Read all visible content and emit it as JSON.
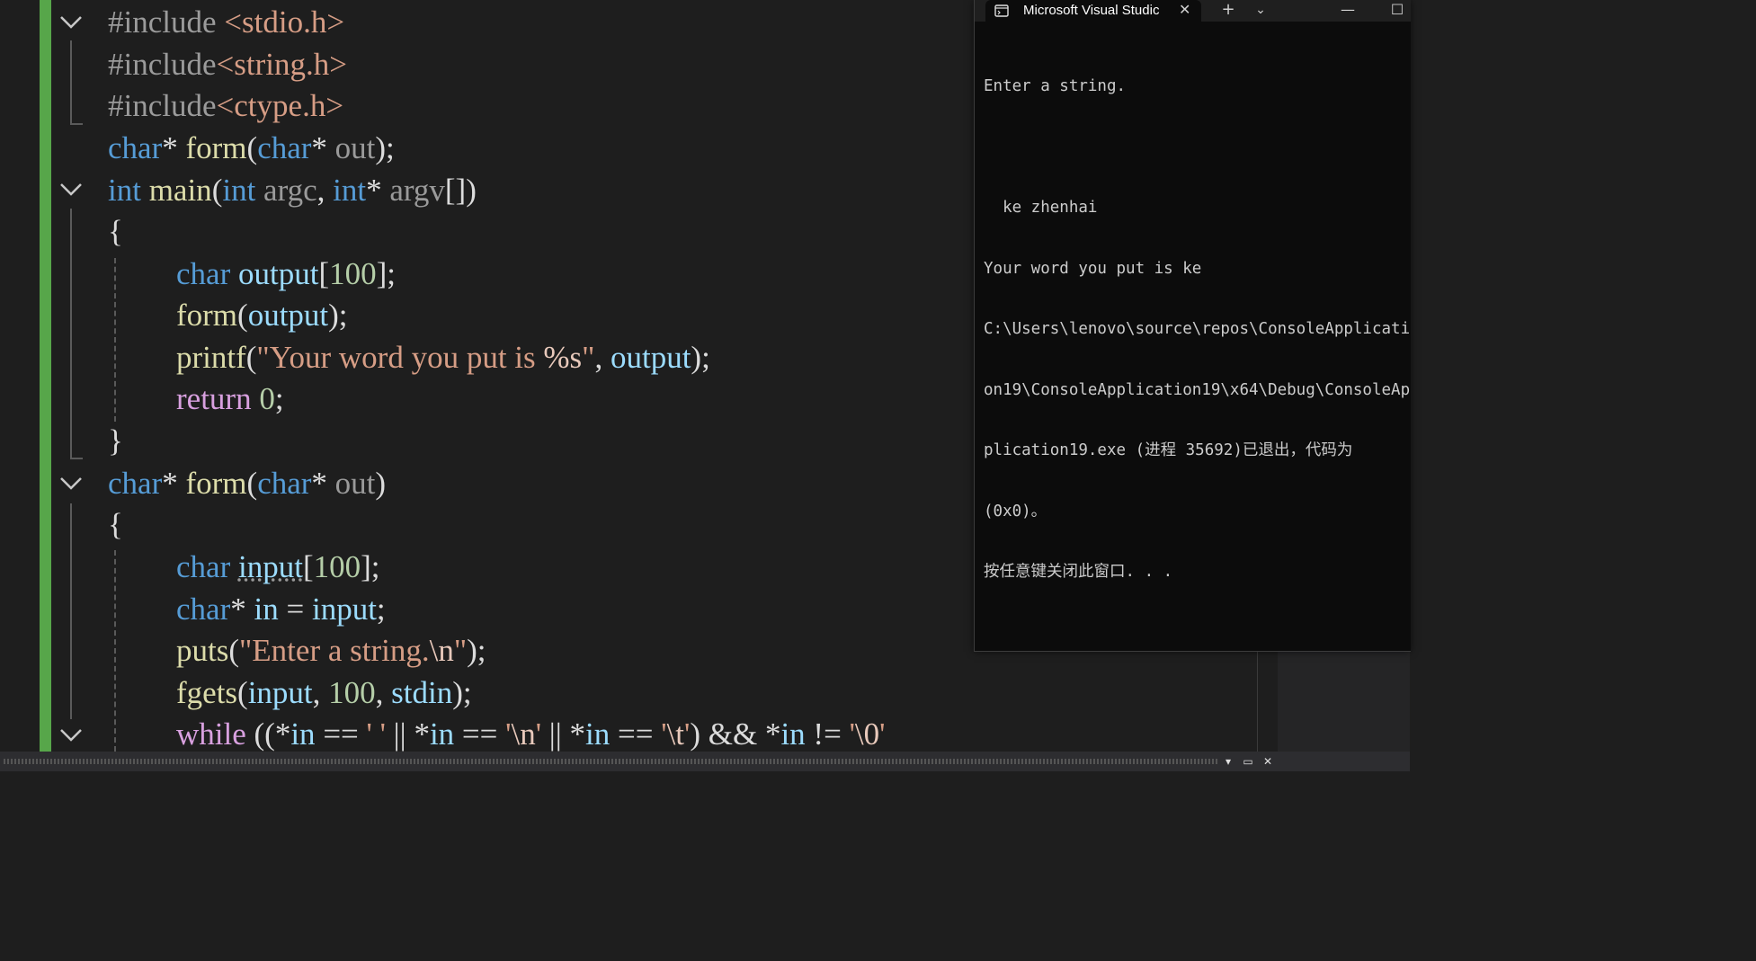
{
  "editor": {
    "lines": {
      "l1": [
        "#include",
        " ",
        "<stdio.h>"
      ],
      "l2": [
        "#include",
        "<string.h>"
      ],
      "l3": [
        "#include",
        "<ctype.h>"
      ],
      "l4": [
        "char",
        "*",
        " ",
        "form",
        "(",
        "char",
        "*",
        " ",
        "out",
        ");"
      ],
      "l5": [
        "int",
        " ",
        "main",
        "(",
        "int",
        " ",
        "argc",
        ", ",
        "int",
        "*",
        " ",
        "argv",
        "[])"
      ],
      "l6": [
        "{"
      ],
      "l7": [
        "char",
        " ",
        "output",
        "[",
        "100",
        "];"
      ],
      "l8": [
        "form",
        "(",
        "output",
        ");"
      ],
      "l9": [
        "printf",
        "(",
        "\"Your word you put is ",
        "%s",
        "\"",
        ", ",
        "output",
        ");"
      ],
      "l10": [
        "return",
        " ",
        "0",
        ";"
      ],
      "l11": [
        "}"
      ],
      "l12": [
        "char",
        "*",
        " ",
        "form",
        "(",
        "char",
        "*",
        " ",
        "out",
        ")"
      ],
      "l13": [
        "{"
      ],
      "l14": [
        "char",
        " ",
        "input",
        "[",
        "100",
        "];"
      ],
      "l15": [
        "char",
        "*",
        " ",
        "in",
        " = ",
        "input",
        ";"
      ],
      "l16": [
        "puts",
        "(",
        "\"Enter a string.",
        "\\n",
        "\"",
        ");"
      ],
      "l17": [
        "fgets",
        "(",
        "input",
        ", ",
        "100",
        ", ",
        "stdin",
        ");"
      ],
      "l18": [
        "while",
        " ((",
        "*",
        "in",
        " == ",
        "' '",
        " || ",
        "*",
        "in",
        " == ",
        "'",
        "\\n",
        "'",
        " || ",
        "*",
        "in",
        " == ",
        "'",
        "\\t",
        "'",
        ") && ",
        "*",
        "in",
        " != ",
        "'",
        "\\0",
        "'"
      ]
    }
  },
  "console": {
    "tab_title": "Microsoft Visual Studic",
    "tab_icon": "terminal-icon",
    "output_lines": [
      "Enter a string.",
      "",
      "  ke zhenhai",
      "Your word you put is ke",
      "C:\\Users\\lenovo\\source\\repos\\ConsoleApplicati",
      "on19\\ConsoleApplication19\\x64\\Debug\\ConsoleAp",
      "plication19.exe (进程 35692)已退出，代码为",
      "(0x0)。",
      "按任意键关闭此窗口. . ."
    ]
  },
  "colors": {
    "editor_bg": "#1e1e1e",
    "keyword": "#569cd6",
    "control_keyword": "#d8a0df",
    "function": "#dcdcaa",
    "string": "#d69d85",
    "number": "#b5cea8",
    "variable": "#9cdcfe",
    "change_bar": "#57a64a",
    "console_bg": "#0c0c0c"
  }
}
